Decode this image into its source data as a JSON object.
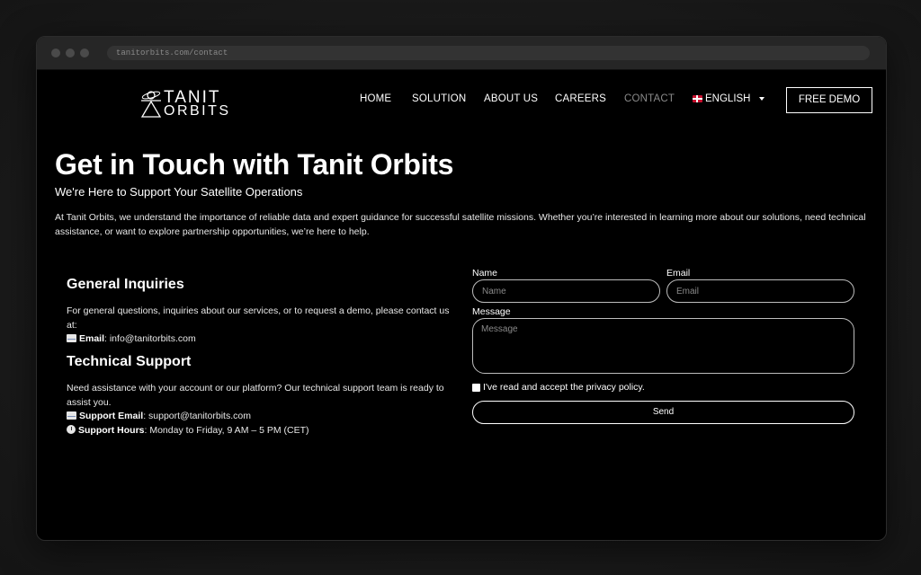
{
  "browser": {
    "url": "tanitorbits.com/contact"
  },
  "logo": {
    "line1": "TANIT",
    "line2": "ORBITS"
  },
  "nav": {
    "items": [
      "HOME",
      "SOLUTION",
      "ABOUT US",
      "CAREERS",
      "CONTACT"
    ],
    "active": "CONTACT",
    "language": "ENGLISH",
    "demo_button": "FREE DEMO"
  },
  "hero": {
    "title": "Get in Touch with Tanit Orbits",
    "subtitle": "We're Here to Support Your Satellite Operations",
    "intro": "At Tanit Orbits, we understand the importance of reliable data and expert guidance for successful satellite missions. Whether you’re interested in learning more about our solutions, need technical assistance, or want to explore partnership opportunities, we’re here to help."
  },
  "general": {
    "title": "General Inquiries",
    "text": "For general questions, inquiries about our services, or to request a demo, please contact us at:",
    "email_label": "Email",
    "email_value": ": info@tanitorbits.com"
  },
  "support": {
    "title": "Technical Support",
    "text": "Need assistance with your account or our platform? Our technical support team is ready to assist you.",
    "email_label": "Support Email",
    "email_value": ": support@tanitorbits.com",
    "hours_label": "Support Hours",
    "hours_value": ": Monday to Friday, 9 AM – 5 PM (CET)"
  },
  "form": {
    "name_label": "Name",
    "name_placeholder": "Name",
    "email_label": "Email",
    "email_placeholder": "Email",
    "message_label": "Message",
    "message_placeholder": "Message",
    "privacy_label": "I've read and accept the privacy policy.",
    "send_label": "Send"
  },
  "icons": {
    "email": "envelope-icon",
    "hours": "clock-icon",
    "flag": "uk-flag-icon",
    "caret": "chevron-down-icon"
  },
  "colors": {
    "background": "#000000",
    "text": "#ffffff",
    "nav_active": "#8a8a8a",
    "border": "#bdbdbd"
  }
}
